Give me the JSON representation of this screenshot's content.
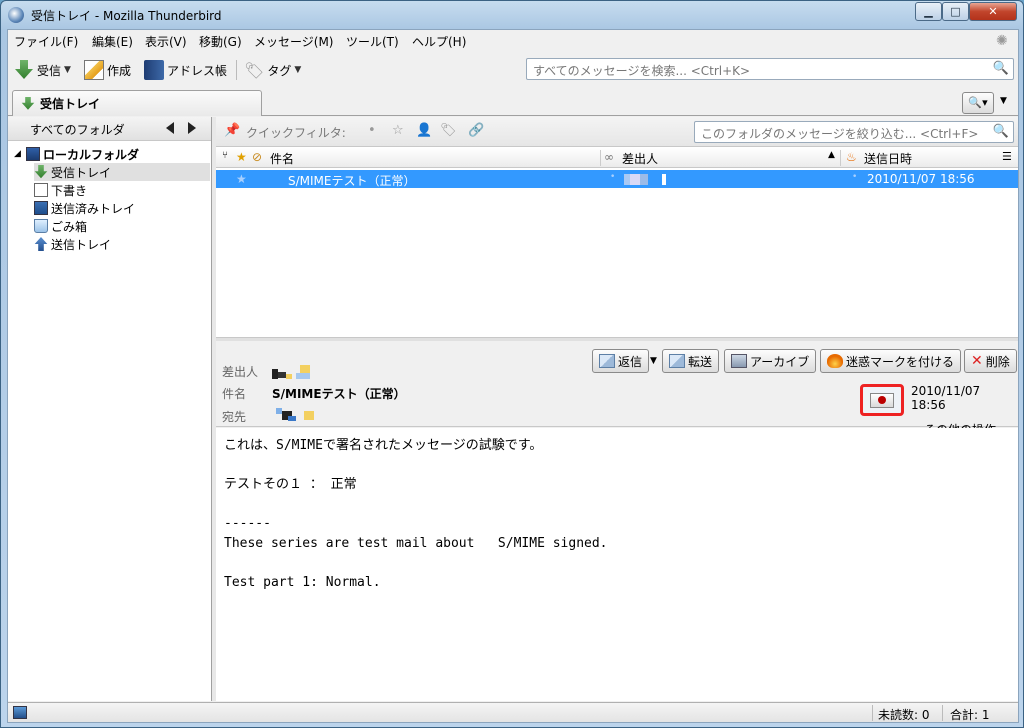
{
  "window": {
    "title": "受信トレイ - Mozilla Thunderbird"
  },
  "menu": [
    "ファイル(F)",
    "編集(E)",
    "表示(V)",
    "移動(G)",
    "メッセージ(M)",
    "ツール(T)",
    "ヘルプ(H)"
  ],
  "toolbar": {
    "get_mail": "受信",
    "write": "作成",
    "address_book": "アドレス帳",
    "tag": "タグ",
    "search_placeholder": "すべてのメッセージを検索... <Ctrl+K>"
  },
  "tab": {
    "label": "受信トレイ"
  },
  "folder_pane": {
    "header": "すべてのフォルダ",
    "account": "ローカルフォルダ",
    "folders": [
      "受信トレイ",
      "下書き",
      "送信済みトレイ",
      "ごみ箱",
      "送信トレイ"
    ]
  },
  "quick_filter": {
    "label": "クイックフィルタ:",
    "placeholder": "このフォルダのメッセージを絞り込む... <Ctrl+F>"
  },
  "thread_columns": {
    "subject": "件名",
    "sender": "差出人",
    "date": "送信日時"
  },
  "messages": [
    {
      "subject": "S/MIMEテスト（正常）",
      "date": "2010/11/07 18:56"
    }
  ],
  "message_header": {
    "from_label": "差出人",
    "subject_label": "件名",
    "to_label": "宛先",
    "subject": "S/MIMEテスト（正常）",
    "date": "2010/11/07 18:56",
    "buttons": {
      "reply": "返信",
      "forward": "転送",
      "archive": "アーカイブ",
      "junk": "迷惑マークを付ける",
      "delete": "削除"
    },
    "more_actions": "その他の操作"
  },
  "body": [
    "これは、S/MIMEで署名されたメッセージの試験です。",
    "",
    "テストその１ ： 正常",
    "",
    "------",
    "These series are test mail about   S/MIME signed.",
    "",
    "Test part 1: Normal."
  ],
  "status": {
    "unread": "未読数: 0",
    "total": "合計: 1"
  },
  "colors": {
    "selection": "#3399ff",
    "smime_highlight": "#ee2222"
  }
}
